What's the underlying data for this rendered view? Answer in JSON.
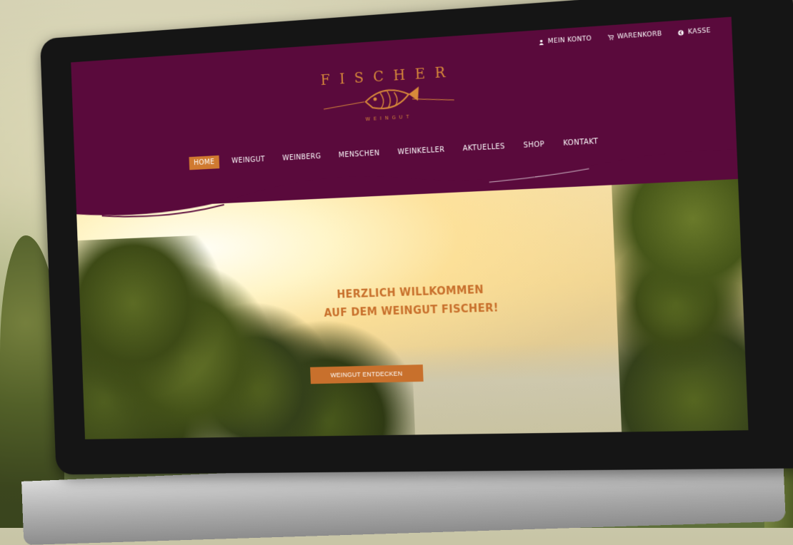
{
  "site": {
    "logo": {
      "name": "FISCHER",
      "subtitle": "WEINGUT"
    },
    "topbar": [
      {
        "label": "MEIN KONTO",
        "icon": "user-icon"
      },
      {
        "label": "WARENKORB",
        "icon": "cart-icon"
      },
      {
        "label": "KASSE",
        "icon": "checkout-icon"
      }
    ],
    "nav": [
      {
        "label": "HOME",
        "active": true
      },
      {
        "label": "WEINGUT",
        "active": false
      },
      {
        "label": "WEINBERG",
        "active": false
      },
      {
        "label": "MENSCHEN",
        "active": false
      },
      {
        "label": "WEINKELLER",
        "active": false
      },
      {
        "label": "AKTUELLES",
        "active": false
      },
      {
        "label": "SHOP",
        "active": false
      },
      {
        "label": "KONTAKT",
        "active": false
      }
    ],
    "hero": {
      "title_line1": "HERZLICH WILLKOMMEN",
      "title_line2": "AUF DEM WEINGUT FISCHER!",
      "cta_label": "WEINGUT ENTDECKEN"
    }
  },
  "colors": {
    "header_bg": "#5a0a3c",
    "accent": "#d07a30",
    "hero_title": "#c8702c"
  }
}
